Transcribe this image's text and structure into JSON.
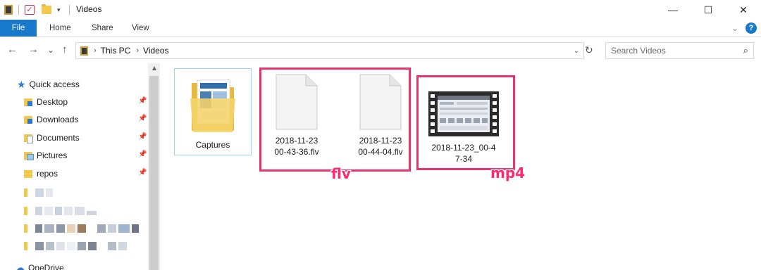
{
  "window": {
    "title": "Videos",
    "controls": {
      "minimize": "—",
      "maximize": "☐",
      "close": "✕"
    }
  },
  "ribbon": {
    "tabs": [
      "File",
      "Home",
      "Share",
      "View"
    ],
    "help": "?"
  },
  "address": {
    "back": "←",
    "forward": "→",
    "recent": "⌄",
    "up": "↑",
    "crumbs": [
      "This PC",
      "Videos"
    ],
    "refresh": "↻",
    "search_placeholder": "Search Videos",
    "search_icon": "⌕"
  },
  "sidebar": {
    "quick_access": "Quick access",
    "items": [
      {
        "label": "Desktop",
        "icon": "desktop-folder-icon",
        "pinned": true
      },
      {
        "label": "Downloads",
        "icon": "downloads-folder-icon",
        "pinned": true
      },
      {
        "label": "Documents",
        "icon": "documents-folder-icon",
        "pinned": true
      },
      {
        "label": "Pictures",
        "icon": "pictures-folder-icon",
        "pinned": true
      },
      {
        "label": "repos",
        "icon": "folder-icon",
        "pinned": true
      }
    ],
    "onedrive": "OneDrive"
  },
  "files": [
    {
      "name": "Captures",
      "type": "folder"
    },
    {
      "name": "2018-11-23 00-43-36.flv",
      "line1": "2018-11-23",
      "line2": "00-43-36.flv",
      "type": "flv"
    },
    {
      "name": "2018-11-23 00-44-04.flv",
      "line1": "2018-11-23",
      "line2": "00-44-04.flv",
      "type": "flv"
    },
    {
      "name": "2018-11-23_00-47-34",
      "line1": "2018-11-23_00-4",
      "line2": "7-34",
      "type": "mp4"
    }
  ],
  "annotations": {
    "flv": "flv",
    "mp4": "mp4",
    "color": "#e8336d"
  }
}
